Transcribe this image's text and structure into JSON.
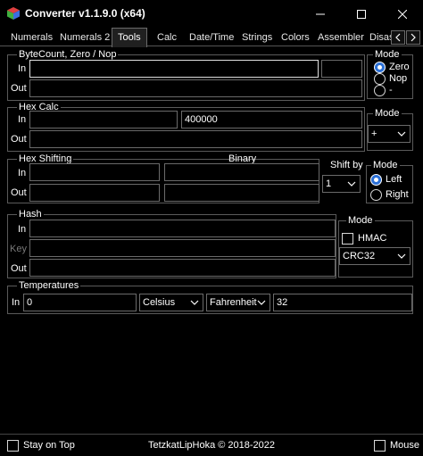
{
  "window": {
    "title": "Converter v1.1.9.0 (x64)"
  },
  "tabs": [
    {
      "label": "Numerals"
    },
    {
      "label": "Numerals 2"
    },
    {
      "label": "Tools",
      "active": true
    },
    {
      "label": "Calc"
    },
    {
      "label": "Date/Time"
    },
    {
      "label": "Strings"
    },
    {
      "label": "Colors"
    },
    {
      "label": "Assembler"
    },
    {
      "label": "Disas"
    }
  ],
  "bytecount": {
    "title": "ByteCount, Zero / Nop",
    "in_label": "In",
    "out_label": "Out",
    "in_value": "",
    "count_value": "",
    "out_value": "",
    "mode_title": "Mode",
    "modes": [
      {
        "label": "Zero",
        "selected": true
      },
      {
        "label": "Nop",
        "selected": false
      },
      {
        "label": "-",
        "selected": false
      }
    ]
  },
  "hexcalc": {
    "title": "Hex Calc",
    "in_label": "In",
    "out_label": "Out",
    "in_value": "",
    "operand_value": "400000",
    "out_value": "",
    "mode_title": "Mode",
    "operator": "+"
  },
  "hexshift": {
    "title": "Hex Shifting",
    "binary_title": "Binary",
    "in_label": "In",
    "out_label": "Out",
    "shift_title": "Shift by",
    "shift_value": "1",
    "mode_title": "Mode",
    "modes": [
      {
        "label": "Left",
        "selected": true
      },
      {
        "label": "Right",
        "selected": false
      }
    ]
  },
  "hash": {
    "title": "Hash",
    "in_label": "In",
    "key_label": "Key",
    "out_label": "Out",
    "mode_title": "Mode",
    "hmac_label": "HMAC",
    "algorithm": "CRC32"
  },
  "temperatures": {
    "title": "Temperatures",
    "in_label": "In",
    "in_value": "0",
    "from_unit": "Celsius",
    "to_unit": "Fahrenheit",
    "result": "32"
  },
  "footer": {
    "stay_on_top": "Stay on Top",
    "copyright": "TetzkatLipHoka © 2018-2022",
    "mouse": "Mouse"
  },
  "colors": {
    "background": "#000000",
    "border": "#5a5a5a",
    "radio_selected": "#2a6fd6"
  }
}
